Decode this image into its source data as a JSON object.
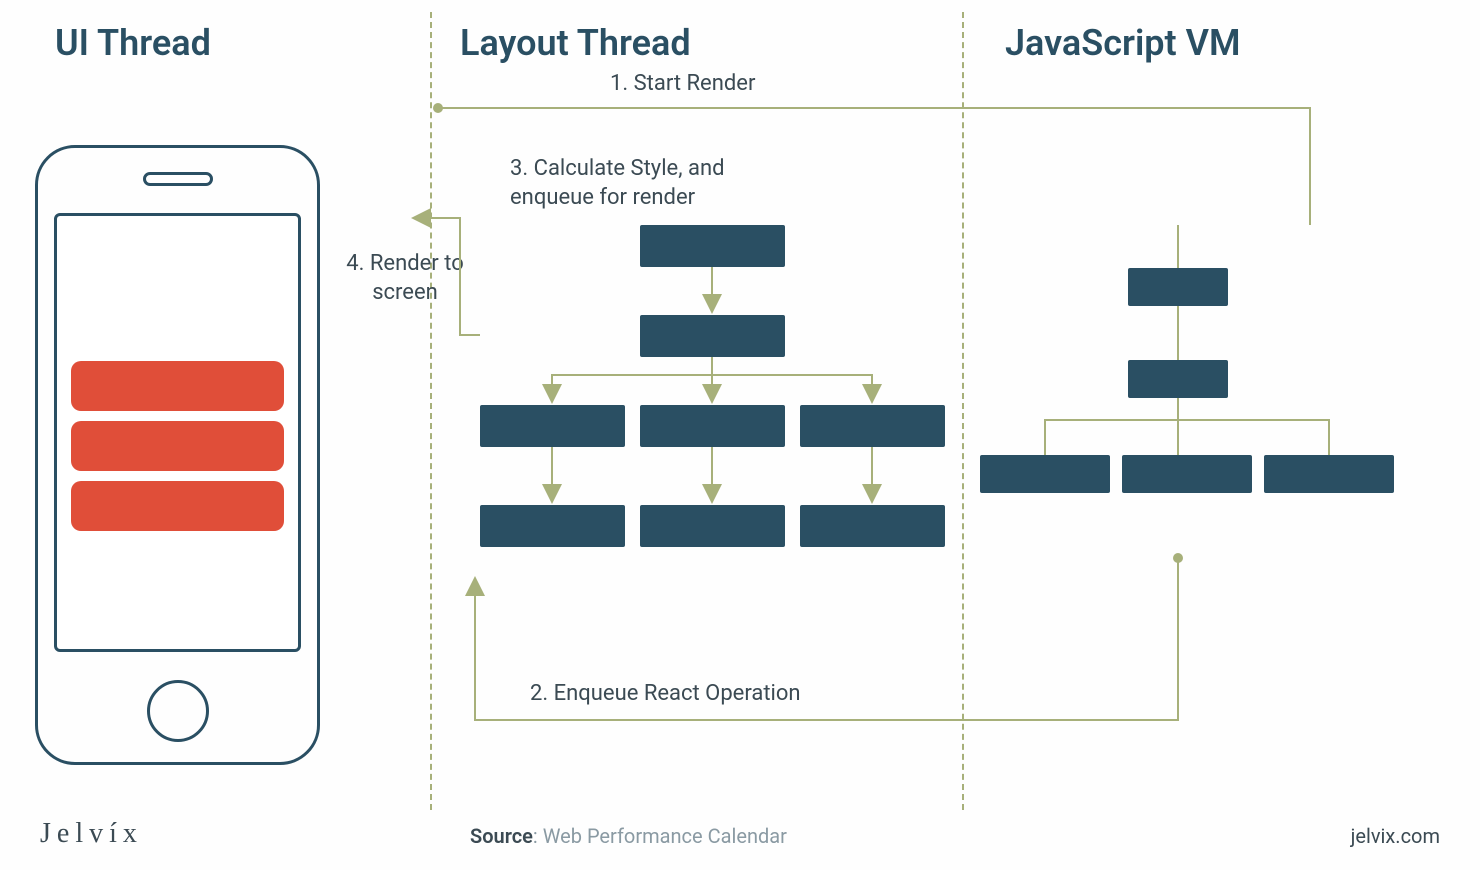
{
  "columns": {
    "ui": "UI Thread",
    "layout": "Layout Thread",
    "jsvm": "JavaScript VM"
  },
  "steps": {
    "s1": "1. Start Render",
    "s2": "2. Enqueue React Operation",
    "s3a": "3. Calculate Style, and",
    "s3b": "enqueue for render",
    "s4a": "4. Render to",
    "s4b": "screen"
  },
  "footer": {
    "brand": "Jelvíx",
    "sourceLabel": "Source",
    "sourceValue": "Web Performance Calendar",
    "site": "jelvix.com"
  }
}
